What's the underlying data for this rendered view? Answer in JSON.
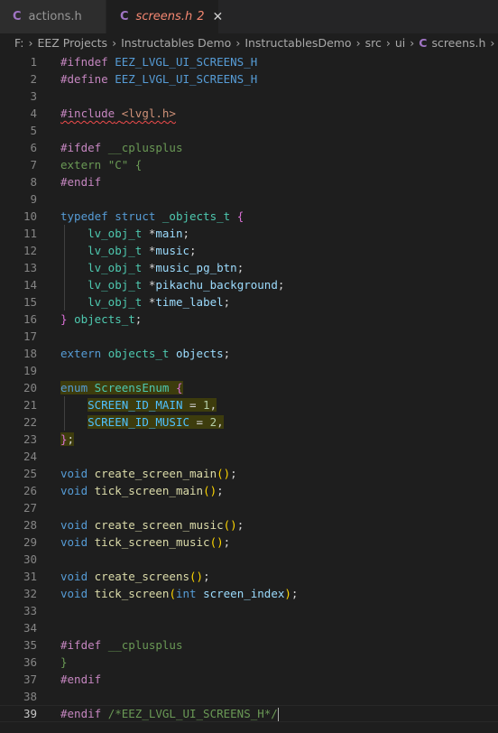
{
  "tabs": [
    {
      "label": "actions.h",
      "icon": "C"
    },
    {
      "label": "screens.h",
      "icon": "C",
      "badge": "2",
      "close": "✕"
    }
  ],
  "breadcrumb": [
    "F:",
    "EEZ Projects",
    "Instructables Demo",
    "InstructablesDemo",
    "src",
    "ui",
    "screens.h",
    "..."
  ],
  "lines": [
    {
      "n": "1",
      "t": [
        [
          "kp",
          "#ifndef"
        ],
        [
          "pl",
          " "
        ],
        [
          "mac",
          "EEZ_LVGL_UI_SCREENS_H"
        ]
      ]
    },
    {
      "n": "2",
      "t": [
        [
          "kp",
          "#define"
        ],
        [
          "pl",
          " "
        ],
        [
          "mac",
          "EEZ_LVGL_UI_SCREENS_H"
        ]
      ]
    },
    {
      "n": "3",
      "t": []
    },
    {
      "n": "4",
      "t": [
        [
          "kp squig",
          "#include"
        ],
        [
          "pl squig",
          " "
        ],
        [
          "st squig",
          "<lvgl.h>"
        ]
      ]
    },
    {
      "n": "5",
      "t": []
    },
    {
      "n": "6",
      "t": [
        [
          "kp",
          "#ifdef"
        ],
        [
          "pl",
          " "
        ],
        [
          "cm",
          "__cplusplus"
        ]
      ]
    },
    {
      "n": "7",
      "t": [
        [
          "cm",
          "extern"
        ],
        [
          "pl",
          " "
        ],
        [
          "cm",
          "\"C\""
        ],
        [
          "pl",
          " "
        ],
        [
          "cm",
          "{"
        ]
      ]
    },
    {
      "n": "8",
      "t": [
        [
          "kp",
          "#endif"
        ]
      ]
    },
    {
      "n": "9",
      "t": []
    },
    {
      "n": "10",
      "t": [
        [
          "kw",
          "typedef"
        ],
        [
          "pl",
          " "
        ],
        [
          "kw",
          "struct"
        ],
        [
          "pl",
          " "
        ],
        [
          "ty",
          "_objects_t"
        ],
        [
          "pl",
          " "
        ],
        [
          "br2",
          "{"
        ]
      ]
    },
    {
      "n": "11",
      "t": [
        [
          "pl",
          "    "
        ],
        [
          "ty",
          "lv_obj_t"
        ],
        [
          "pl",
          " *"
        ],
        [
          "id",
          "main"
        ],
        [
          "pl",
          ";"
        ]
      ]
    },
    {
      "n": "12",
      "t": [
        [
          "pl",
          "    "
        ],
        [
          "ty",
          "lv_obj_t"
        ],
        [
          "pl",
          " *"
        ],
        [
          "id",
          "music"
        ],
        [
          "pl",
          ";"
        ]
      ]
    },
    {
      "n": "13",
      "t": [
        [
          "pl",
          "    "
        ],
        [
          "ty",
          "lv_obj_t"
        ],
        [
          "pl",
          " *"
        ],
        [
          "id",
          "music_pg_btn"
        ],
        [
          "pl",
          ";"
        ]
      ]
    },
    {
      "n": "14",
      "t": [
        [
          "pl",
          "    "
        ],
        [
          "ty",
          "lv_obj_t"
        ],
        [
          "pl",
          " *"
        ],
        [
          "id",
          "pikachu_background"
        ],
        [
          "pl",
          ";"
        ]
      ]
    },
    {
      "n": "15",
      "t": [
        [
          "pl",
          "    "
        ],
        [
          "ty",
          "lv_obj_t"
        ],
        [
          "pl",
          " *"
        ],
        [
          "id",
          "time_label"
        ],
        [
          "pl",
          ";"
        ]
      ]
    },
    {
      "n": "16",
      "t": [
        [
          "br2",
          "}"
        ],
        [
          "pl",
          " "
        ],
        [
          "ty",
          "objects_t"
        ],
        [
          "pl",
          ";"
        ]
      ]
    },
    {
      "n": "17",
      "t": []
    },
    {
      "n": "18",
      "t": [
        [
          "kw",
          "extern"
        ],
        [
          "pl",
          " "
        ],
        [
          "ty",
          "objects_t"
        ],
        [
          "pl",
          " "
        ],
        [
          "id",
          "objects"
        ],
        [
          "pl",
          ";"
        ]
      ]
    },
    {
      "n": "19",
      "t": []
    },
    {
      "n": "20",
      "t": [
        [
          "kw hl",
          "enum"
        ],
        [
          "pl hl",
          " "
        ],
        [
          "ty hl",
          "ScreensEnum"
        ],
        [
          "pl hl",
          " "
        ],
        [
          "br2 hl",
          "{"
        ]
      ]
    },
    {
      "n": "21",
      "t": [
        [
          "pl",
          "    "
        ],
        [
          "cn hl",
          "SCREEN_ID_MAIN"
        ],
        [
          "pl hl",
          " = "
        ],
        [
          "nu hl",
          "1"
        ],
        [
          "pl hl",
          ","
        ]
      ]
    },
    {
      "n": "22",
      "t": [
        [
          "pl",
          "    "
        ],
        [
          "cn hl",
          "SCREEN_ID_MUSIC"
        ],
        [
          "pl hl",
          " = "
        ],
        [
          "nu hl",
          "2"
        ],
        [
          "pl hl",
          ","
        ]
      ]
    },
    {
      "n": "23",
      "t": [
        [
          "br2 hl",
          "}"
        ],
        [
          "pl hl",
          ";"
        ]
      ]
    },
    {
      "n": "24",
      "t": []
    },
    {
      "n": "25",
      "t": [
        [
          "kw",
          "void"
        ],
        [
          "pl",
          " "
        ],
        [
          "fn",
          "create_screen_main"
        ],
        [
          "br",
          "()"
        ],
        [
          "pl",
          ";"
        ]
      ]
    },
    {
      "n": "26",
      "t": [
        [
          "kw",
          "void"
        ],
        [
          "pl",
          " "
        ],
        [
          "fn",
          "tick_screen_main"
        ],
        [
          "br",
          "()"
        ],
        [
          "pl",
          ";"
        ]
      ]
    },
    {
      "n": "27",
      "t": []
    },
    {
      "n": "28",
      "t": [
        [
          "kw",
          "void"
        ],
        [
          "pl",
          " "
        ],
        [
          "fn",
          "create_screen_music"
        ],
        [
          "br",
          "()"
        ],
        [
          "pl",
          ";"
        ]
      ]
    },
    {
      "n": "29",
      "t": [
        [
          "kw",
          "void"
        ],
        [
          "pl",
          " "
        ],
        [
          "fn",
          "tick_screen_music"
        ],
        [
          "br",
          "()"
        ],
        [
          "pl",
          ";"
        ]
      ]
    },
    {
      "n": "30",
      "t": []
    },
    {
      "n": "31",
      "t": [
        [
          "kw",
          "void"
        ],
        [
          "pl",
          " "
        ],
        [
          "fn",
          "create_screens"
        ],
        [
          "br",
          "()"
        ],
        [
          "pl",
          ";"
        ]
      ]
    },
    {
      "n": "32",
      "t": [
        [
          "kw",
          "void"
        ],
        [
          "pl",
          " "
        ],
        [
          "fn",
          "tick_screen"
        ],
        [
          "br",
          "("
        ],
        [
          "kw",
          "int"
        ],
        [
          "pl",
          " "
        ],
        [
          "id",
          "screen_index"
        ],
        [
          "br",
          ")"
        ],
        [
          "pl",
          ";"
        ]
      ]
    },
    {
      "n": "33",
      "t": []
    },
    {
      "n": "34",
      "t": []
    },
    {
      "n": "35",
      "t": [
        [
          "kp",
          "#ifdef"
        ],
        [
          "pl",
          " "
        ],
        [
          "cm",
          "__cplusplus"
        ]
      ]
    },
    {
      "n": "36",
      "t": [
        [
          "cm",
          "}"
        ]
      ]
    },
    {
      "n": "37",
      "t": [
        [
          "kp",
          "#endif"
        ]
      ]
    },
    {
      "n": "38",
      "t": []
    },
    {
      "n": "39",
      "t": [
        [
          "kp",
          "#endif"
        ],
        [
          "pl",
          " "
        ],
        [
          "cm",
          "/*EEZ_LVGL_UI_SCREENS_H*/"
        ]
      ]
    }
  ],
  "current_line": "39",
  "colors": {
    "background": "#1e1e1e",
    "tab_bar": "#252526",
    "modified_tab": "#f48771",
    "c_icon": "#a074c4"
  }
}
